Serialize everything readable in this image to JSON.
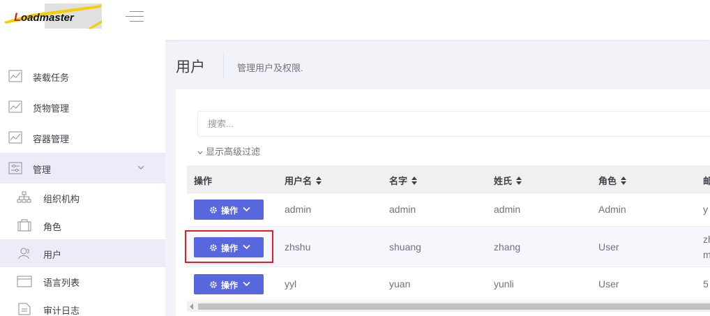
{
  "header": {
    "logo_text": "Loadmaster",
    "menu_toggle_icon": "hamburger-menu-icon"
  },
  "sidebar": {
    "items": [
      {
        "label": "装载任务",
        "icon": "chart-line-icon"
      },
      {
        "label": "货物管理",
        "icon": "chart-line-icon"
      },
      {
        "label": "容器管理",
        "icon": "chart-line-icon"
      },
      {
        "label": "管理",
        "icon": "settings-sliders-icon",
        "expanded": true
      }
    ],
    "subitems": [
      {
        "label": "组织机构",
        "icon": "org-tree-icon"
      },
      {
        "label": "角色",
        "icon": "briefcase-icon"
      },
      {
        "label": "用户",
        "icon": "users-icon",
        "active": true
      },
      {
        "label": "语言列表",
        "icon": "window-icon"
      },
      {
        "label": "审计日志",
        "icon": "document-icon"
      }
    ]
  },
  "page": {
    "title": "用户",
    "description": "管理用户及权限."
  },
  "search": {
    "placeholder": "搜索..."
  },
  "filter": {
    "advanced_label": "显示高级过滤"
  },
  "table": {
    "columns": [
      "操作",
      "用户名",
      "名字",
      "姓氏",
      "角色",
      "邮"
    ],
    "action_label": "操作",
    "rows": [
      {
        "username": "admin",
        "name": "admin",
        "surname": "admin",
        "role": "Admin",
        "email": "y"
      },
      {
        "username": "zhshu",
        "name": "shuang",
        "surname": "zhang",
        "role": "User",
        "email": "zh"
      },
      {
        "username": "yyl",
        "name": "yuan",
        "surname": "yunli",
        "role": "User",
        "email": "5"
      }
    ],
    "row2_email_line2": "m"
  },
  "colors": {
    "accent": "#5867dd",
    "active_bg": "#ececf8",
    "highlight": "#e02020"
  }
}
